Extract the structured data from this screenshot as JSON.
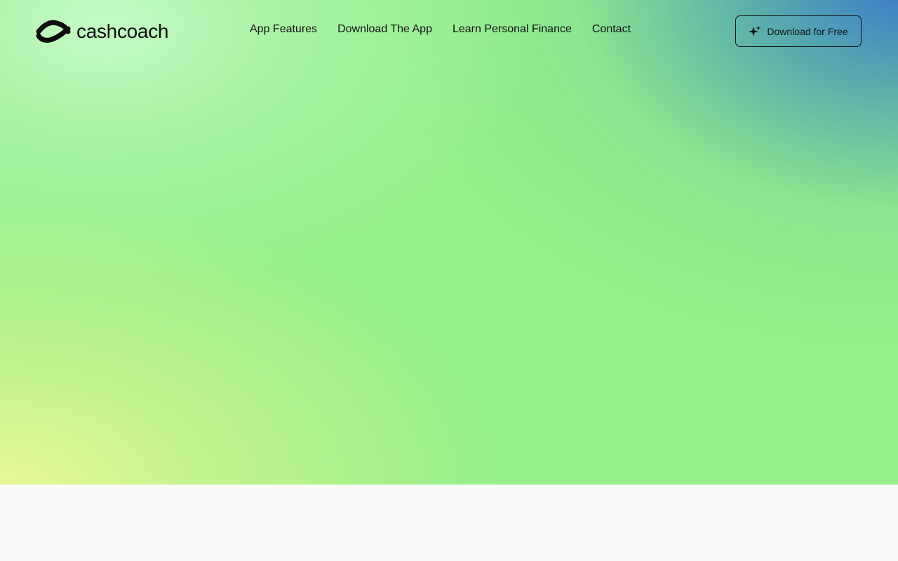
{
  "brand": {
    "name": "cashcoach",
    "logo_icon": "cashcoach-s-mark-icon"
  },
  "nav": {
    "items": [
      {
        "label": "App Features"
      },
      {
        "label": "Download The App"
      },
      {
        "label": "Learn Personal Finance"
      },
      {
        "label": "Contact"
      }
    ],
    "cta": {
      "label": "Download for Free",
      "icon": "sparkle-icon"
    }
  },
  "colors": {
    "hero_base": "#95f08a",
    "hero_top_right": "#3a7ac8",
    "hero_bottom_left": "#e8f896",
    "page_background": "#fafafa",
    "text": "#111111"
  }
}
